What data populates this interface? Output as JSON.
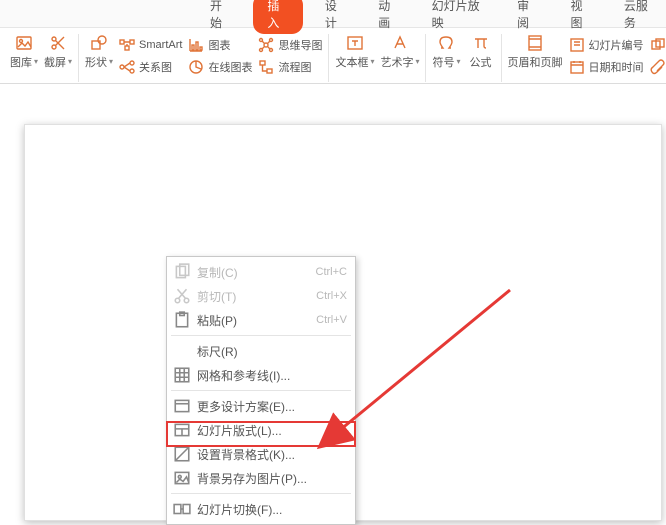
{
  "tabs": {
    "items": [
      "开始",
      "插入",
      "设计",
      "动画",
      "幻灯片放映",
      "审阅",
      "视图",
      "云服务"
    ],
    "active_index": 1
  },
  "ribbon": {
    "image_lib": "图库",
    "screenshot": "截屏",
    "shapes": "形状",
    "smartart": "SmartArt",
    "relation": "关系图",
    "chart": "图表",
    "online_chart": "在线图表",
    "mindmap": "思维导图",
    "flowchart": "流程图",
    "textbox": "文本框",
    "wordart": "艺术字",
    "symbol": "符号",
    "equation": "公式",
    "header_footer": "页眉和页脚",
    "slide_number": "幻灯片编号",
    "object": "对象",
    "date_time": "日期和时间",
    "attachment": "附件"
  },
  "ctx": {
    "copy": "复制(C)",
    "copy_sc": "Ctrl+C",
    "cut": "剪切(T)",
    "cut_sc": "Ctrl+X",
    "paste": "粘贴(P)",
    "paste_sc": "Ctrl+V",
    "ruler": "标尺(R)",
    "grid": "网格和参考线(I)...",
    "more_design": "更多设计方案(E)...",
    "layout": "幻灯片版式(L)...",
    "bg_format": "设置背景格式(K)...",
    "bg_save": "背景另存为图片(P)...",
    "transition": "幻灯片切换(F)..."
  }
}
